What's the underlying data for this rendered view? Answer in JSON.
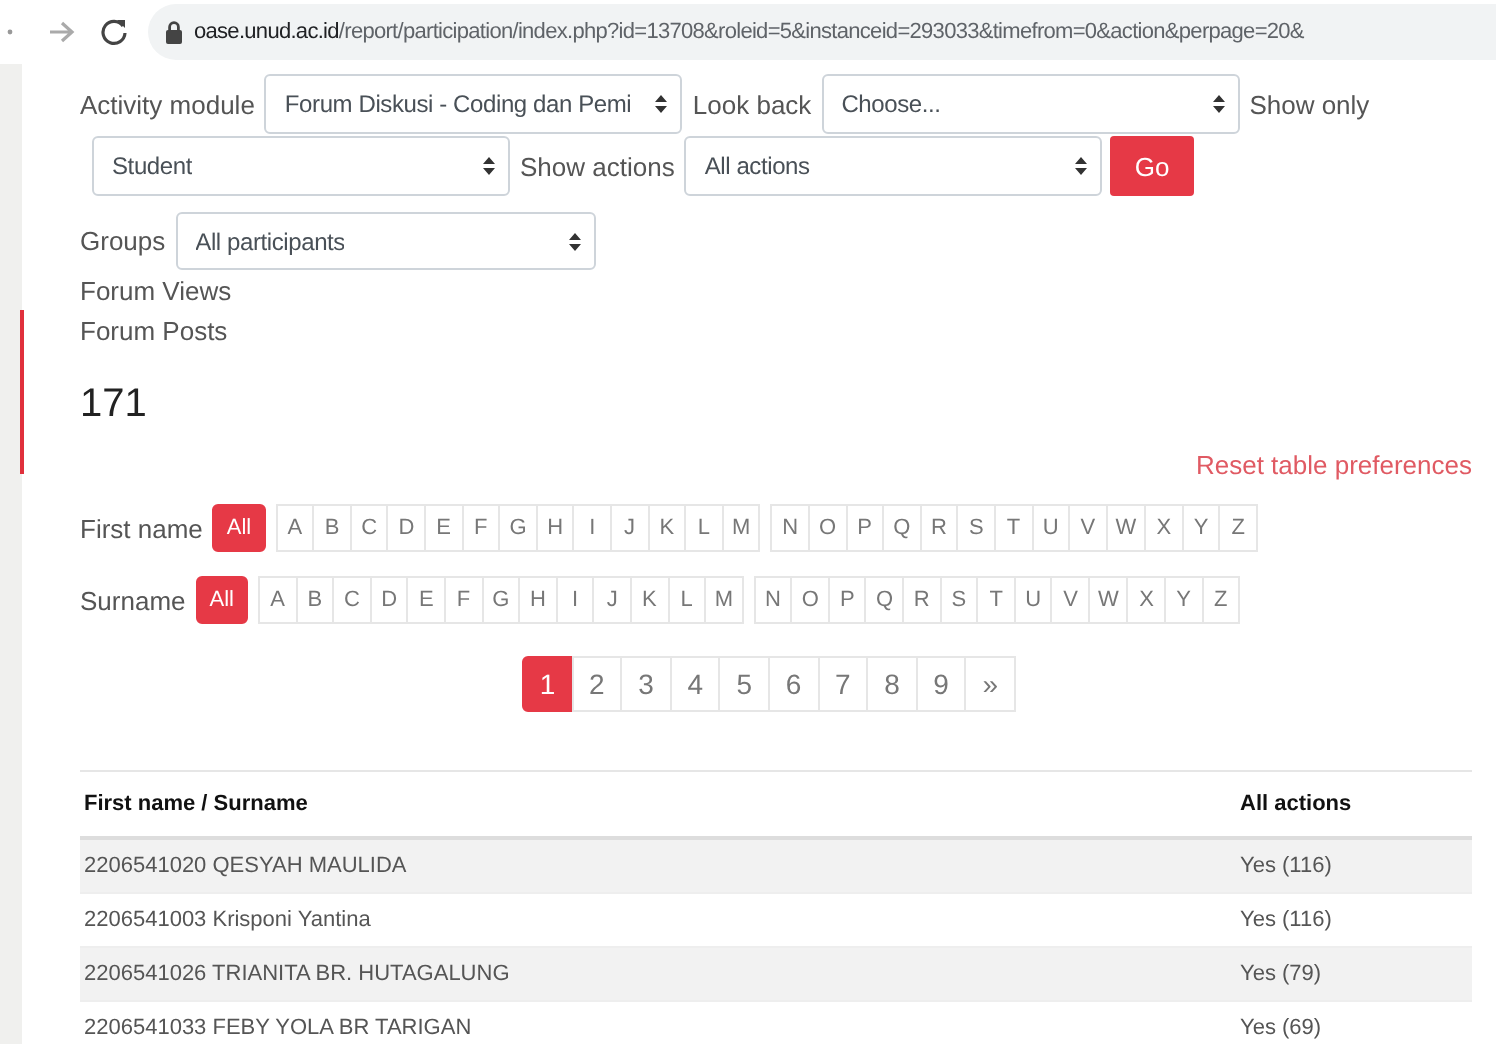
{
  "browser": {
    "url_host": "oase.unud.ac.id",
    "url_path": "/report/participation/index.php?id=13708&roleid=5&instanceid=293033&timefrom=0&action&perpage=20&"
  },
  "filter_rows": [
    [
      {
        "kind": "label",
        "text": "Activity module"
      },
      {
        "kind": "select",
        "value": "Forum Diskusi - Coding dan Pemi"
      },
      {
        "kind": "label",
        "text": "Look back"
      },
      {
        "kind": "select",
        "value": "Choose..."
      },
      {
        "kind": "label",
        "text": "Show only"
      }
    ],
    [
      {
        "kind": "select",
        "value": "Student"
      },
      {
        "kind": "label",
        "text": "Show actions"
      },
      {
        "kind": "select",
        "value": "All actions"
      },
      {
        "kind": "button",
        "text": "Go"
      }
    ]
  ],
  "groups": {
    "label": "Groups",
    "value": "All participants"
  },
  "report_lines": [
    "Forum Views",
    "Forum Posts"
  ],
  "count": "171",
  "reset_link": "Reset table preferences",
  "initials_bars": [
    {
      "label": "First name",
      "groups": [
        [
          {
            "text": "All",
            "selected": true
          }
        ],
        [
          {
            "text": "A",
            "selected": false
          },
          {
            "text": "B",
            "selected": false
          },
          {
            "text": "C",
            "selected": false
          },
          {
            "text": "D",
            "selected": false
          },
          {
            "text": "E",
            "selected": false
          },
          {
            "text": "F",
            "selected": false
          },
          {
            "text": "G",
            "selected": false
          },
          {
            "text": "H",
            "selected": false
          },
          {
            "text": "I",
            "selected": false
          },
          {
            "text": "J",
            "selected": false
          },
          {
            "text": "K",
            "selected": false
          },
          {
            "text": "L",
            "selected": false
          },
          {
            "text": "M",
            "selected": false
          }
        ],
        [
          {
            "text": "N",
            "selected": false
          },
          {
            "text": "O",
            "selected": false
          },
          {
            "text": "P",
            "selected": false
          },
          {
            "text": "Q",
            "selected": false
          },
          {
            "text": "R",
            "selected": false
          },
          {
            "text": "S",
            "selected": false
          },
          {
            "text": "T",
            "selected": false
          },
          {
            "text": "U",
            "selected": false
          },
          {
            "text": "V",
            "selected": false
          },
          {
            "text": "W",
            "selected": false
          },
          {
            "text": "X",
            "selected": false
          },
          {
            "text": "Y",
            "selected": false
          },
          {
            "text": "Z",
            "selected": false
          }
        ]
      ]
    },
    {
      "label": "Surname",
      "groups": [
        [
          {
            "text": "All",
            "selected": true
          }
        ],
        [
          {
            "text": "A",
            "selected": false
          },
          {
            "text": "B",
            "selected": false
          },
          {
            "text": "C",
            "selected": false
          },
          {
            "text": "D",
            "selected": false
          },
          {
            "text": "E",
            "selected": false
          },
          {
            "text": "F",
            "selected": false
          },
          {
            "text": "G",
            "selected": false
          },
          {
            "text": "H",
            "selected": false
          },
          {
            "text": "I",
            "selected": false
          },
          {
            "text": "J",
            "selected": false
          },
          {
            "text": "K",
            "selected": false
          },
          {
            "text": "L",
            "selected": false
          },
          {
            "text": "M",
            "selected": false
          }
        ],
        [
          {
            "text": "N",
            "selected": false
          },
          {
            "text": "O",
            "selected": false
          },
          {
            "text": "P",
            "selected": false
          },
          {
            "text": "Q",
            "selected": false
          },
          {
            "text": "R",
            "selected": false
          },
          {
            "text": "S",
            "selected": false
          },
          {
            "text": "T",
            "selected": false
          },
          {
            "text": "U",
            "selected": false
          },
          {
            "text": "V",
            "selected": false
          },
          {
            "text": "W",
            "selected": false
          },
          {
            "text": "X",
            "selected": false
          },
          {
            "text": "Y",
            "selected": false
          },
          {
            "text": "Z",
            "selected": false
          }
        ]
      ]
    }
  ],
  "pagination": [
    {
      "text": "1",
      "selected": true
    },
    {
      "text": "2",
      "selected": false
    },
    {
      "text": "3",
      "selected": false
    },
    {
      "text": "4",
      "selected": false
    },
    {
      "text": "5",
      "selected": false
    },
    {
      "text": "6",
      "selected": false
    },
    {
      "text": "7",
      "selected": false
    },
    {
      "text": "8",
      "selected": false
    },
    {
      "text": "9",
      "selected": false
    },
    {
      "text": "»",
      "selected": false
    }
  ],
  "table": {
    "columns": [
      "First name / Surname",
      "All actions"
    ],
    "rows": [
      [
        "2206541020 QESYAH MAULIDA",
        "Yes (116)"
      ],
      [
        "2206541003 Krisponi Yantina",
        "Yes (116)"
      ],
      [
        "2206541026 TRIANITA BR. HUTAGALUNG",
        "Yes (79)"
      ],
      [
        "2206541033 FEBY YOLA BR TARIGAN",
        "Yes (69)"
      ]
    ]
  }
}
